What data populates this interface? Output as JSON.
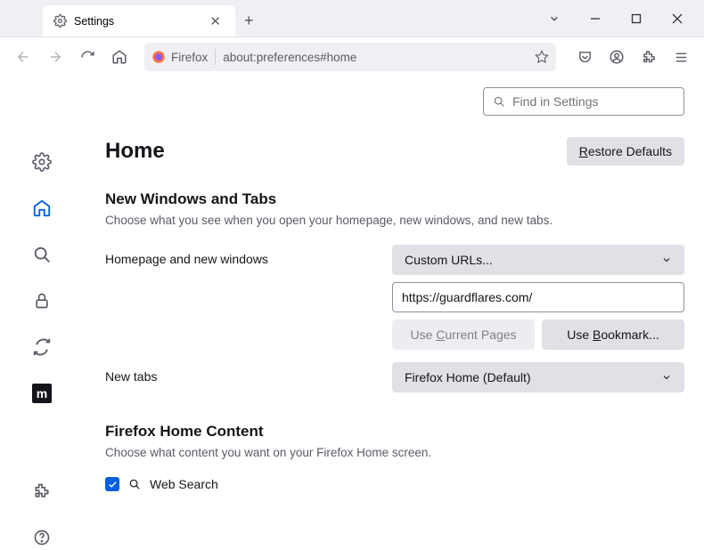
{
  "tab": {
    "title": "Settings"
  },
  "urlbar": {
    "label": "Firefox",
    "address": "about:preferences#home"
  },
  "find": {
    "placeholder": "Find in Settings"
  },
  "page": {
    "title": "Home",
    "restore_r": "R",
    "restore_rest": "estore Defaults"
  },
  "section_new": {
    "heading": "New Windows and Tabs",
    "sub": "Choose what you see when you open your homepage, new windows, and new tabs."
  },
  "homepage": {
    "label": "Homepage and new windows",
    "mode": "Custom URLs...",
    "url": "https://guardflares.com/",
    "use_current_pre": "Use ",
    "use_current_u": "C",
    "use_current_post": "urrent Pages",
    "use_bookmark_pre": "Use ",
    "use_bookmark_u": "B",
    "use_bookmark_post": "ookmark..."
  },
  "newtabs": {
    "label": "New tabs",
    "value": "Firefox Home (Default)"
  },
  "fhc": {
    "heading": "Firefox Home Content",
    "sub": "Choose what content you want on your Firefox Home screen.",
    "websearch": "Web Search"
  }
}
